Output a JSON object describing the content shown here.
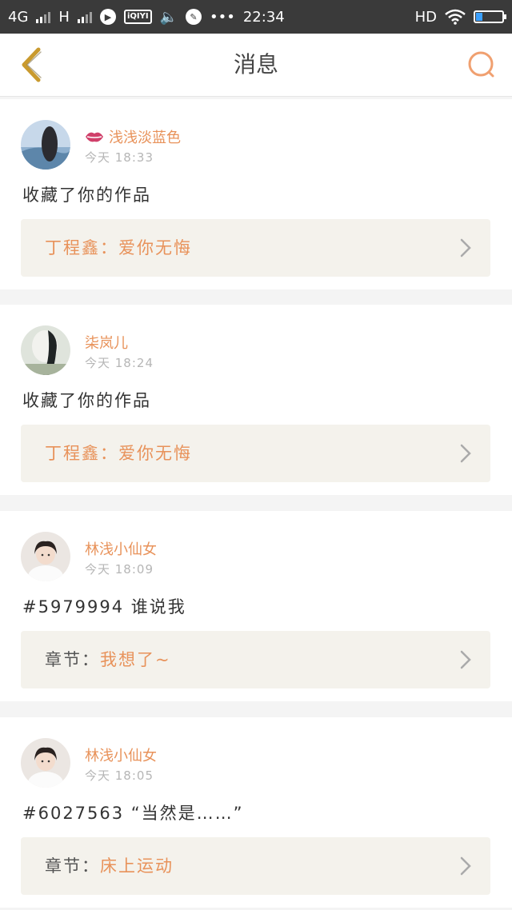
{
  "status_bar": {
    "network": "4G",
    "network2": "H",
    "app_icon2": "iQIYI",
    "more": "•••",
    "time": "22:34",
    "hd": "HD",
    "battery_level": 0.25
  },
  "header": {
    "title": "消息"
  },
  "messages": [
    {
      "user": "浅浅淡蓝色",
      "time": "今天 18:33",
      "action": "收藏了你的作品",
      "ref_prefix": "丁程鑫：",
      "ref_title": "爱你无悔",
      "ref_prefix_orange": true
    },
    {
      "user": "柒岚儿",
      "time": "今天 18:24",
      "action": "收藏了你的作品",
      "ref_prefix": "丁程鑫：",
      "ref_title": "爱你无悔",
      "ref_prefix_orange": true
    },
    {
      "user": "林浅小仙女",
      "time": "今天 18:09",
      "action": "#5979994 谁说我",
      "ref_prefix": "章节：",
      "ref_title": "我想了~",
      "ref_prefix_orange": false
    },
    {
      "user": "林浅小仙女",
      "time": "今天 18:05",
      "action": "#6027563 “当然是……”",
      "ref_prefix": "章节：",
      "ref_title": "床上运动",
      "ref_prefix_orange": false
    }
  ],
  "colors": {
    "accent": "#e8925a",
    "card_ref_bg": "#f4f2ec",
    "status_bg": "#3a3a3a"
  }
}
